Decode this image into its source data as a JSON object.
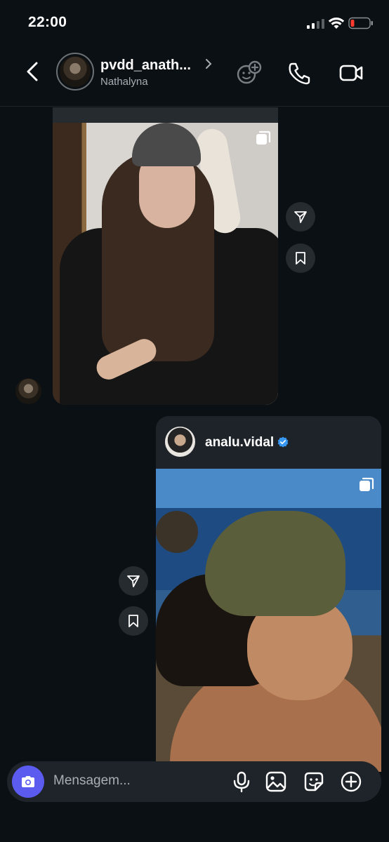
{
  "status_bar": {
    "time": "22:00"
  },
  "header": {
    "username": "pvdd_anath...",
    "subtitle": "Nathalyna"
  },
  "messages": [
    {
      "type": "shared_post",
      "from": "contact"
    },
    {
      "type": "shared_post",
      "from": "me",
      "post_user": "analu.vidal",
      "verified": true
    }
  ],
  "composer": {
    "placeholder": "Mensagem..."
  },
  "colors": {
    "background": "#0b1014",
    "bubble": "#1d2328",
    "camera_button": "#5b5bf0",
    "verified": "#3897f0",
    "battery_low": "#ff3b30"
  }
}
